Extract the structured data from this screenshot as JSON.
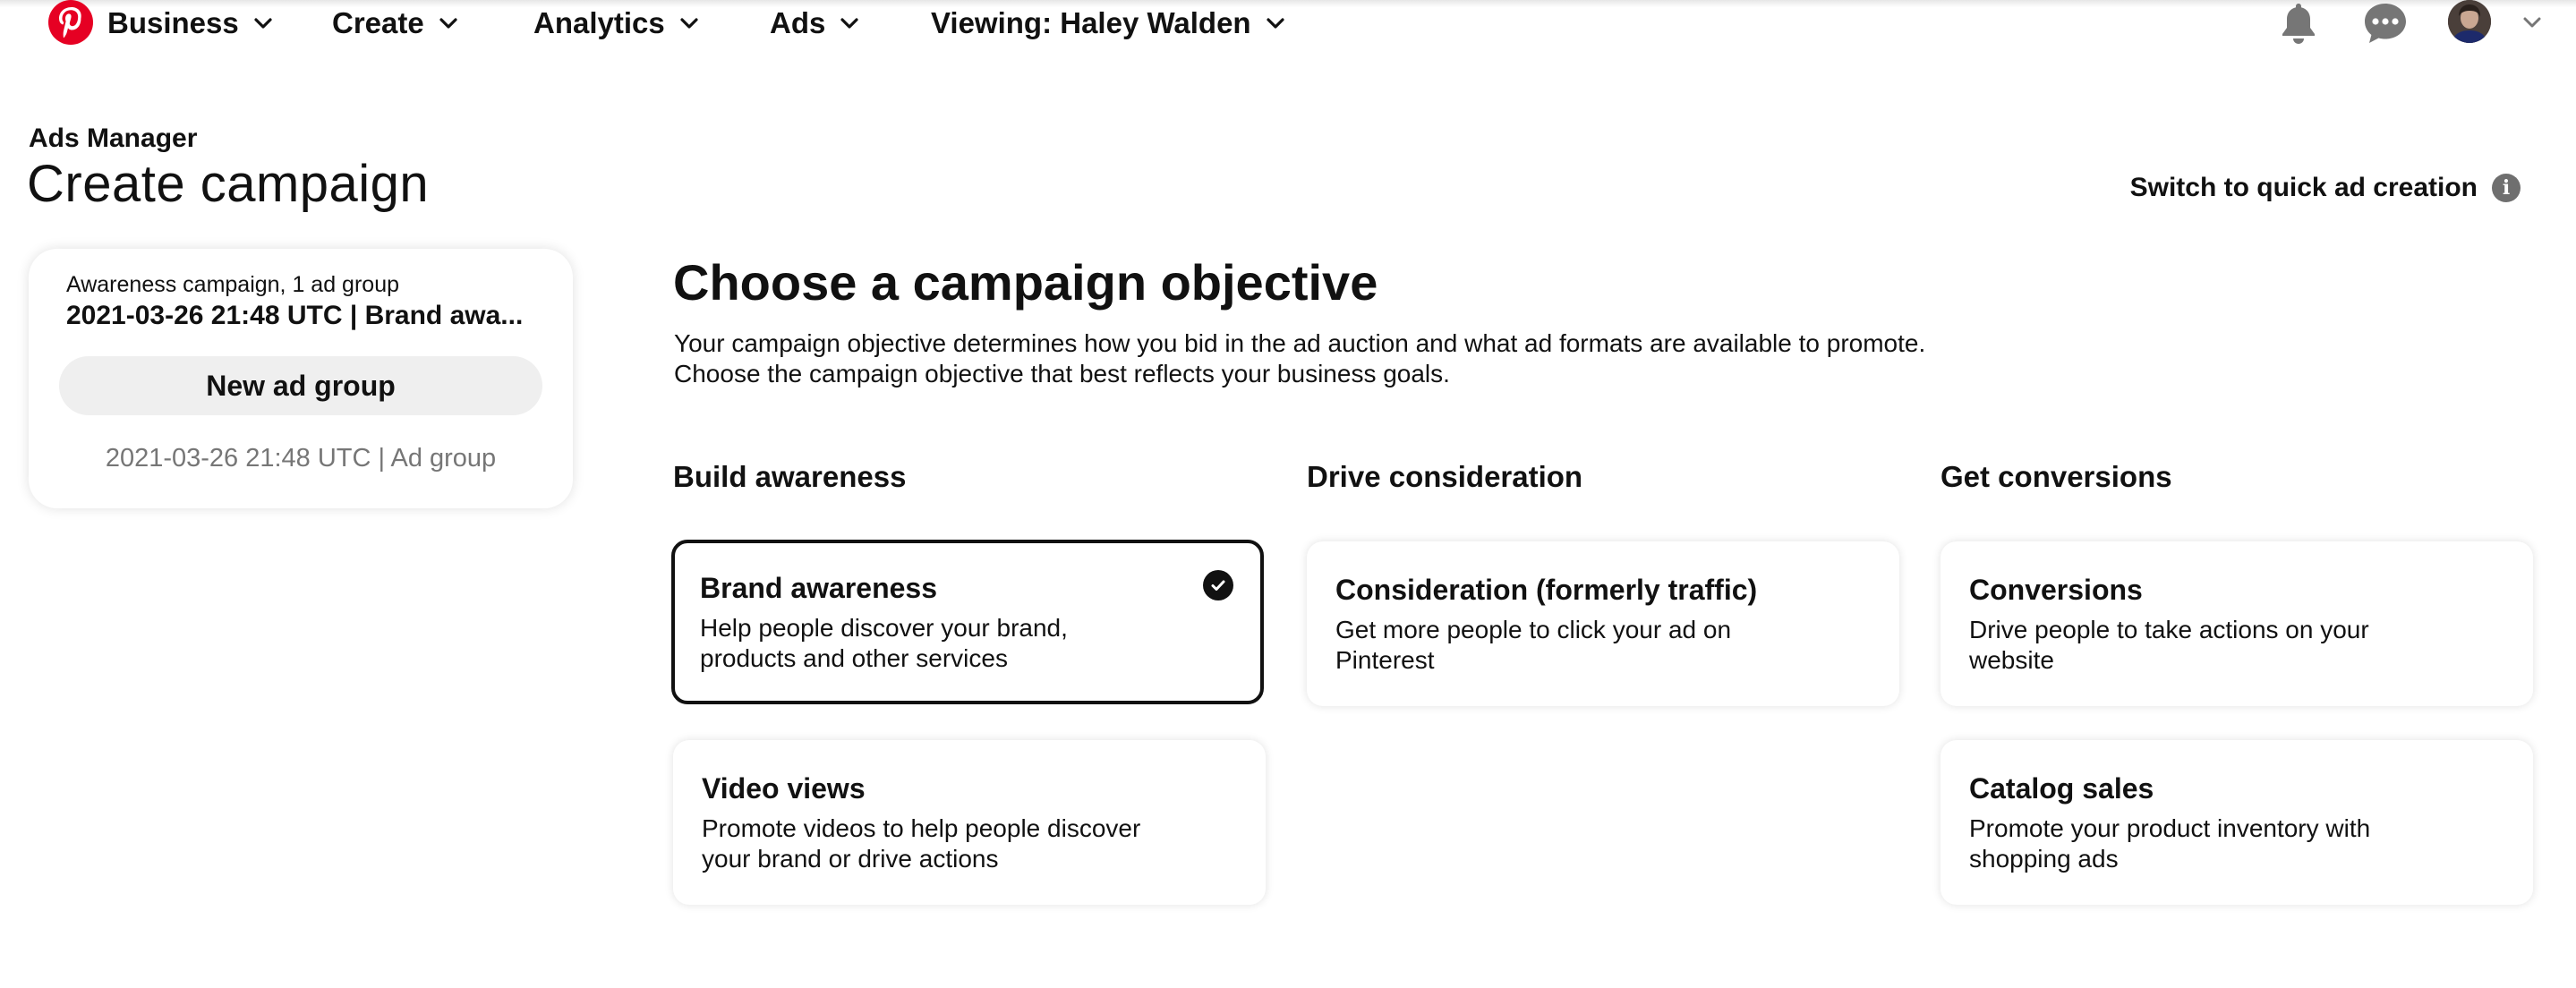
{
  "nav": {
    "items": [
      {
        "label": "Business"
      },
      {
        "label": "Create"
      },
      {
        "label": "Analytics"
      },
      {
        "label": "Ads"
      },
      {
        "label": "Viewing: Haley Walden"
      }
    ],
    "icons": [
      "pinterest-logo",
      "bell-icon",
      "chat-icon",
      "avatar",
      "chevron-down-icon"
    ]
  },
  "header": {
    "eyebrow": "Ads Manager",
    "title": "Create campaign",
    "quick_link": "Switch to quick ad creation",
    "info_glyph": "i"
  },
  "summary": {
    "subtitle": "Awareness campaign, 1 ad group",
    "name": "2021-03-26 21:48 UTC | Brand awa...",
    "new_ad_group": "New ad group",
    "ad_group": "2021-03-26 21:48 UTC | Ad group"
  },
  "main": {
    "title": "Choose a campaign objective",
    "desc_line1": "Your campaign objective determines how you bid in the ad auction and what ad formats are available to promote.",
    "desc_line2": "Choose the campaign objective that best reflects your business goals.",
    "groups": [
      {
        "heading": "Build awareness"
      },
      {
        "heading": "Drive consideration"
      },
      {
        "heading": "Get conversions"
      }
    ],
    "cards": {
      "brand_awareness": {
        "title": "Brand awareness",
        "desc_1": "Help people discover your brand,",
        "desc_2": "products and other services",
        "selected": true
      },
      "video_views": {
        "title": "Video views",
        "desc_1": "Promote videos to help people discover",
        "desc_2": "your brand or drive actions",
        "selected": false
      },
      "consideration": {
        "title": "Consideration (formerly traffic)",
        "desc_1": "Get more people to click your ad on",
        "desc_2": "Pinterest",
        "selected": false
      },
      "conversions": {
        "title": "Conversions",
        "desc_1": "Drive people to take actions on your",
        "desc_2": "website",
        "selected": false
      },
      "catalog_sales": {
        "title": "Catalog sales",
        "desc_1": "Promote your product inventory with",
        "desc_2": "shopping ads",
        "selected": false
      }
    }
  },
  "colors": {
    "brand": "#e60023",
    "text": "#111111",
    "muted": "#767676",
    "button_bg": "#efefef"
  }
}
